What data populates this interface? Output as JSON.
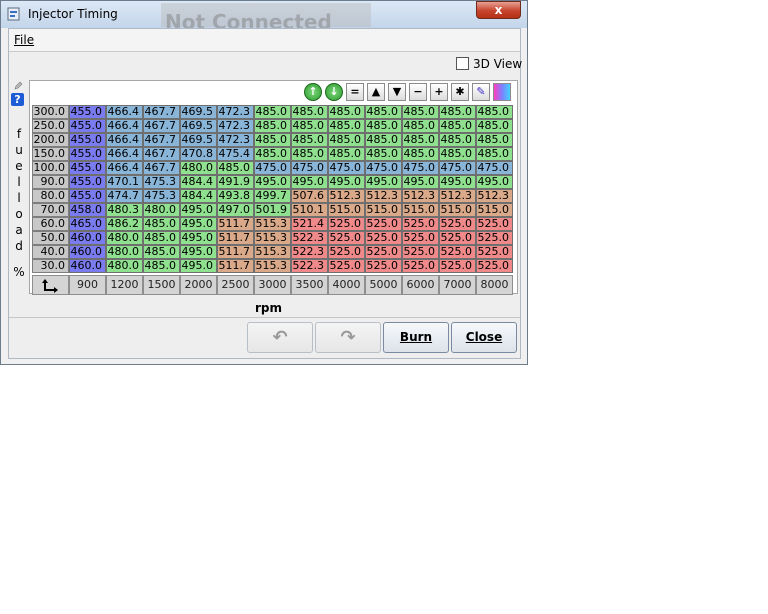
{
  "window": {
    "title": "Injector Timing",
    "close_glyph": "x",
    "background_title": "Not Connected"
  },
  "menu": {
    "file_label": "File"
  },
  "view3d": {
    "label": "3D View",
    "checked": false
  },
  "sidebar": {
    "help_glyph": "?",
    "axis_label_chars": [
      "f",
      "u",
      "e",
      "l",
      "l",
      "o",
      "a",
      "d",
      "%"
    ]
  },
  "toolbar": {
    "buttons": [
      {
        "name": "increment-big-button",
        "glyph": "↑"
      },
      {
        "name": "decrement-big-button",
        "glyph": "↓"
      },
      {
        "name": "set-equal-button",
        "glyph": "="
      },
      {
        "name": "increase-button",
        "glyph": "▲"
      },
      {
        "name": "decrease-button",
        "glyph": "▼"
      },
      {
        "name": "minus-button",
        "glyph": "−"
      },
      {
        "name": "plus-button",
        "glyph": "+"
      },
      {
        "name": "multiply-button",
        "glyph": "✱"
      },
      {
        "name": "pencil-button",
        "glyph": "✎"
      },
      {
        "name": "color-gradient-button",
        "glyph": ""
      }
    ]
  },
  "table": {
    "x_label": "rpm",
    "x_axis": [
      "900",
      "1200",
      "1500",
      "2000",
      "2500",
      "3000",
      "3500",
      "4000",
      "5000",
      "6000",
      "7000",
      "8000"
    ],
    "y_axis": [
      "300.0",
      "250.0",
      "200.0",
      "150.0",
      "100.0",
      "90.0",
      "80.0",
      "70.0",
      "60.0",
      "50.0",
      "40.0",
      "30.0"
    ],
    "rows": [
      [
        "455.0",
        "466.4",
        "467.7",
        "469.5",
        "472.3",
        "485.0",
        "485.0",
        "485.0",
        "485.0",
        "485.0",
        "485.0",
        "485.0"
      ],
      [
        "455.0",
        "466.4",
        "467.7",
        "469.5",
        "472.3",
        "485.0",
        "485.0",
        "485.0",
        "485.0",
        "485.0",
        "485.0",
        "485.0"
      ],
      [
        "455.0",
        "466.4",
        "467.7",
        "469.5",
        "472.3",
        "485.0",
        "485.0",
        "485.0",
        "485.0",
        "485.0",
        "485.0",
        "485.0"
      ],
      [
        "455.0",
        "466.4",
        "467.7",
        "470.8",
        "475.4",
        "485.0",
        "485.0",
        "485.0",
        "485.0",
        "485.0",
        "485.0",
        "485.0"
      ],
      [
        "455.0",
        "466.4",
        "467.7",
        "480.0",
        "485.0",
        "475.0",
        "475.0",
        "475.0",
        "475.0",
        "475.0",
        "475.0",
        "475.0"
      ],
      [
        "455.0",
        "470.1",
        "475.3",
        "484.4",
        "491.9",
        "495.0",
        "495.0",
        "495.0",
        "495.0",
        "495.0",
        "495.0",
        "495.0"
      ],
      [
        "455.0",
        "474.7",
        "475.3",
        "484.4",
        "493.8",
        "499.7",
        "507.6",
        "512.3",
        "512.3",
        "512.3",
        "512.3",
        "512.3"
      ],
      [
        "458.0",
        "480.3",
        "480.0",
        "495.0",
        "497.0",
        "501.9",
        "510.1",
        "515.0",
        "515.0",
        "515.0",
        "515.0",
        "515.0"
      ],
      [
        "465.0",
        "486.2",
        "485.0",
        "495.0",
        "511.7",
        "515.3",
        "521.4",
        "525.0",
        "525.0",
        "525.0",
        "525.0",
        "525.0"
      ],
      [
        "460.0",
        "480.0",
        "485.0",
        "495.0",
        "511.7",
        "515.3",
        "522.3",
        "525.0",
        "525.0",
        "525.0",
        "525.0",
        "525.0"
      ],
      [
        "460.0",
        "480.0",
        "485.0",
        "495.0",
        "511.7",
        "515.3",
        "522.3",
        "525.0",
        "525.0",
        "525.0",
        "525.0",
        "525.0"
      ],
      [
        "460.0",
        "480.0",
        "485.0",
        "495.0",
        "511.7",
        "515.3",
        "522.3",
        "525.0",
        "525.0",
        "525.0",
        "525.0",
        "525.0"
      ]
    ]
  },
  "buttons": {
    "undo_glyph": "↶",
    "redo_glyph": "↷",
    "burn_label": "Burn",
    "close_label": "Close"
  },
  "colors": {
    "low": "#7b7bf0",
    "mid_blue": "#89b5d9",
    "green": "#8fe08f",
    "tan": "#d9a98a",
    "red": "#f08a8a"
  }
}
